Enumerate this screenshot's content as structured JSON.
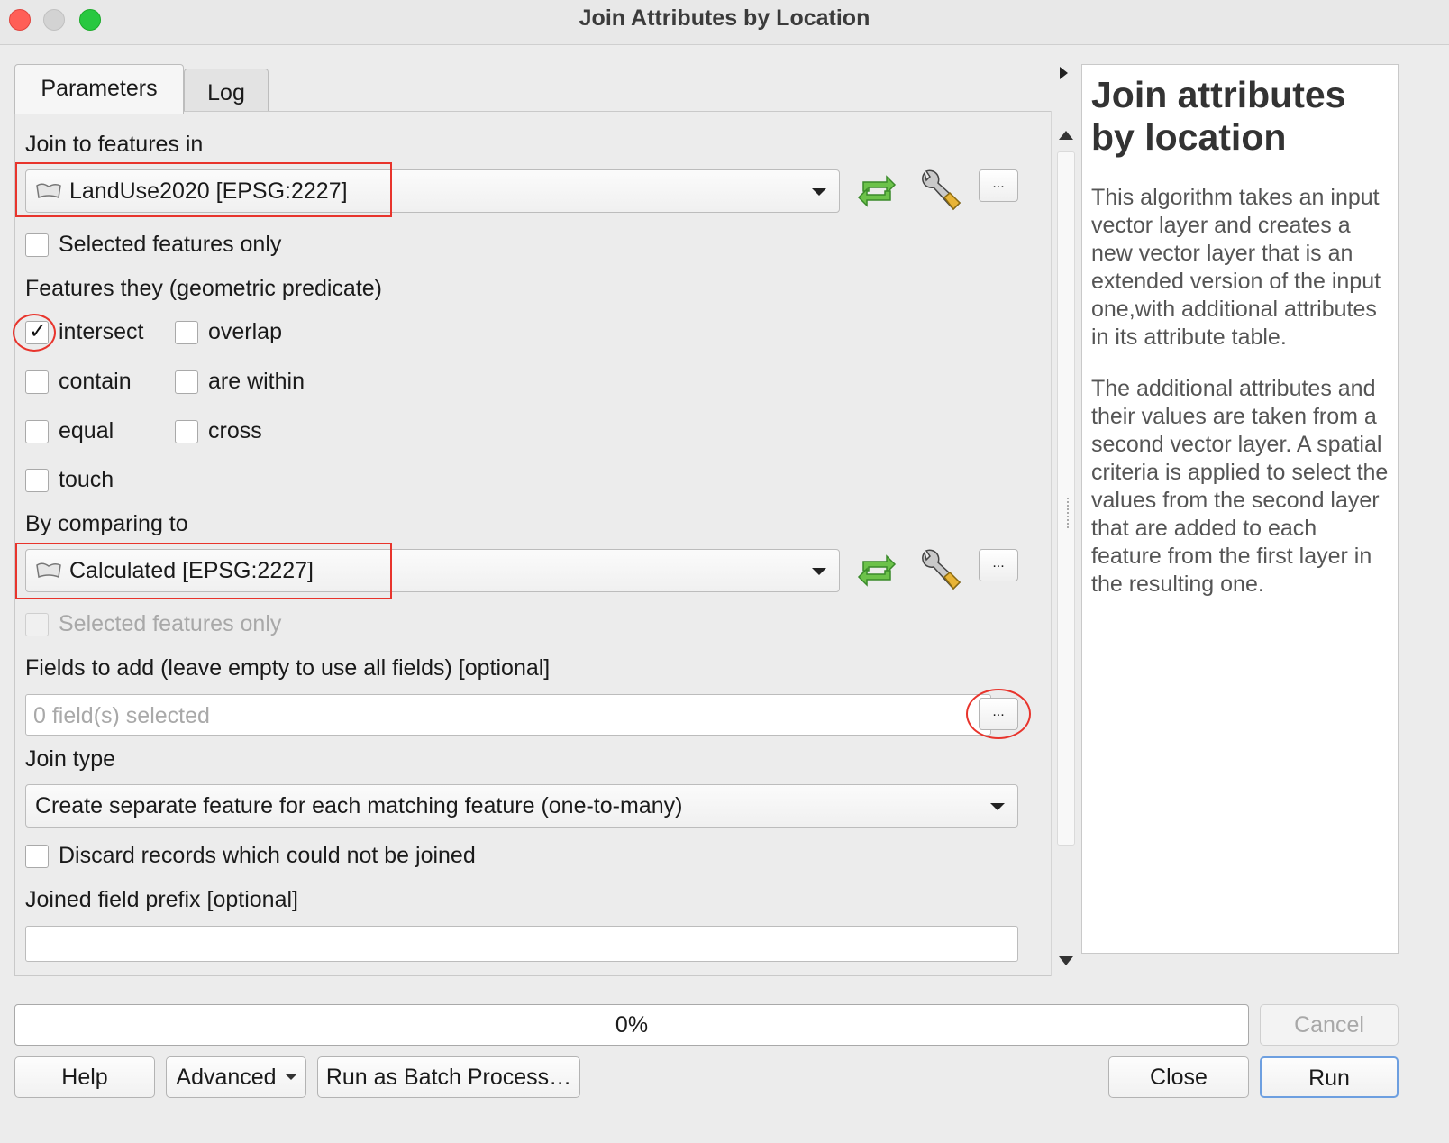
{
  "window": {
    "title": "Join Attributes by Location"
  },
  "tabs": [
    {
      "label": "Parameters"
    },
    {
      "label": "Log"
    }
  ],
  "params": {
    "join_to": {
      "label": "Join to features in",
      "value": "LandUse2020 [EPSG:2227]",
      "selected_only_label": "Selected features only"
    },
    "predicate": {
      "label": "Features they (geometric predicate)",
      "options": [
        "intersect",
        "overlap",
        "contain",
        "are within",
        "equal",
        "cross",
        "touch"
      ]
    },
    "compare": {
      "label": "By comparing to",
      "value": "Calculated [EPSG:2227]",
      "selected_only_label": "Selected features only"
    },
    "fields": {
      "label": "Fields to add (leave empty to use all fields) [optional]",
      "placeholder": "0 field(s) selected",
      "button": "..."
    },
    "join_type": {
      "label": "Join type",
      "value": "Create separate feature for each matching feature (one-to-many)"
    },
    "discard": {
      "label": "Discard records which could not be joined"
    },
    "prefix": {
      "label": "Joined field prefix [optional]"
    }
  },
  "help": {
    "title": "Join attributes by location",
    "p1": "This algorithm takes an input vector layer and creates a new vector layer that is an extended version of the input one,with additional attributes in its attribute table.",
    "p2": "The additional attributes and their values are taken from a second vector layer. A spatial criteria is applied to select the values from the second layer that are added to each feature from the first layer in the resulting one."
  },
  "progress": {
    "text": "0%"
  },
  "buttons": {
    "cancel": "Cancel",
    "help": "Help",
    "advanced": "Advanced",
    "batch": "Run as Batch Process…",
    "close": "Close",
    "run": "Run",
    "more": "..."
  },
  "colors": {
    "annotation": "#e8342c",
    "iterate_icon": "#4caf50",
    "primary_border": "#6d9fe0"
  }
}
